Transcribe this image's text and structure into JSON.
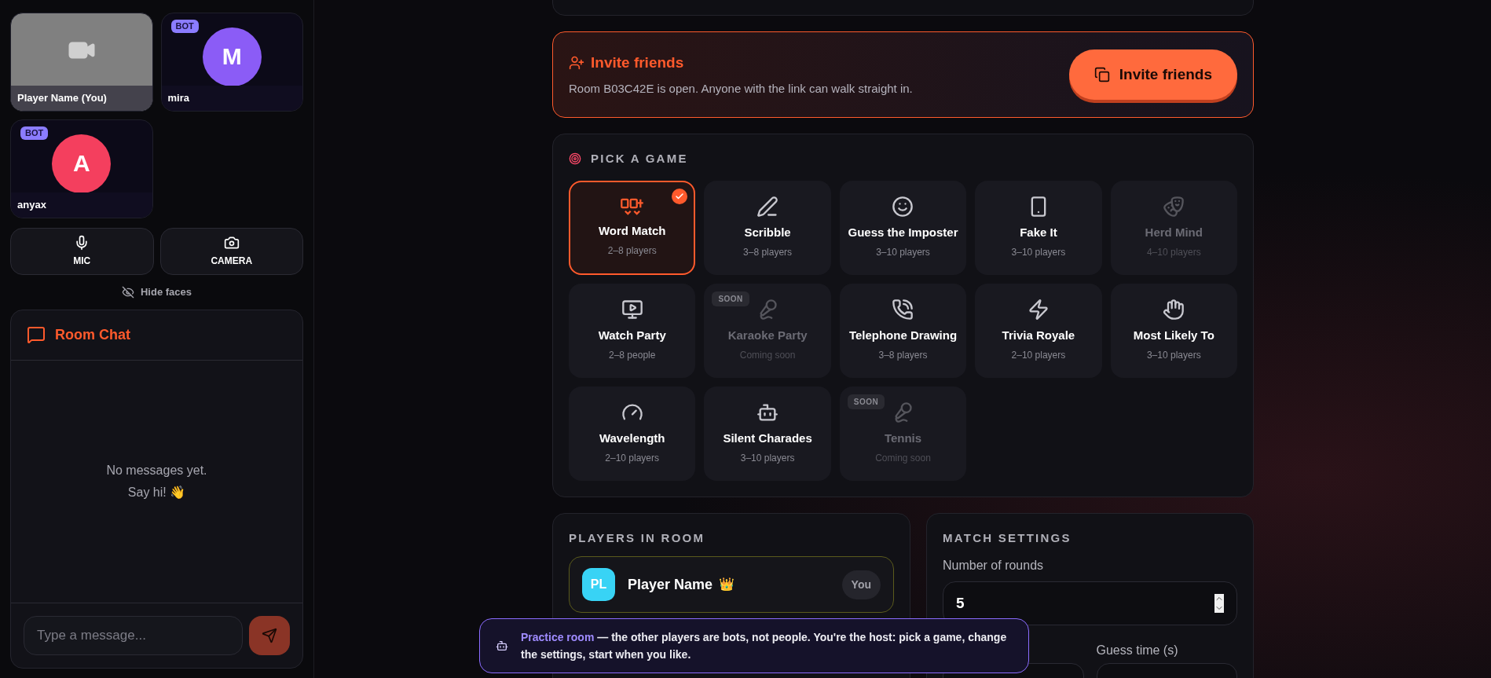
{
  "tiles": [
    {
      "name": "Player Name (You)",
      "kind": "camera"
    },
    {
      "name": "mira",
      "kind": "avatar",
      "badge": "BOT",
      "initial": "M",
      "color": "#8b5cf6"
    },
    {
      "name": "anyax",
      "kind": "avatar",
      "badge": "BOT",
      "initial": "A",
      "color": "#f43f5e"
    }
  ],
  "controls": [
    {
      "label": "MIC"
    },
    {
      "label": "CAMERA"
    }
  ],
  "hide_faces": "Hide faces",
  "chat": {
    "title": "Room Chat",
    "empty": [
      "No messages yet.",
      "Say hi! 👋"
    ],
    "placeholder": "Type a message..."
  },
  "invite": {
    "title": "Invite friends",
    "text": "Room B03C42E is open. Anyone with the link can walk straight in.",
    "button": "Invite friends"
  },
  "pick_game": {
    "title": "PICK A GAME",
    "games": [
      {
        "name": "Word Match",
        "sub": "2–8 players",
        "selected": true,
        "disabled": false
      },
      {
        "name": "Scribble",
        "sub": "3–8 players",
        "selected": false,
        "disabled": false
      },
      {
        "name": "Guess the Imposter",
        "sub": "3–10 players",
        "selected": false,
        "disabled": false
      },
      {
        "name": "Fake It",
        "sub": "3–10 players",
        "selected": false,
        "disabled": false
      },
      {
        "name": "Herd Mind",
        "sub": "4–10 players",
        "selected": false,
        "disabled": true
      },
      {
        "name": "Watch Party",
        "sub": "2–8 people",
        "selected": false,
        "disabled": false
      },
      {
        "name": "Karaoke Party",
        "sub": "Coming soon",
        "selected": false,
        "disabled": true,
        "badge": "SOON"
      },
      {
        "name": "Telephone Drawing",
        "sub": "3–8 players",
        "selected": false,
        "disabled": false
      },
      {
        "name": "Trivia Royale",
        "sub": "2–10 players",
        "selected": false,
        "disabled": false
      },
      {
        "name": "Most Likely To",
        "sub": "3–10 players",
        "selected": false,
        "disabled": false
      },
      {
        "name": "Wavelength",
        "sub": "2–10 players",
        "selected": false,
        "disabled": false
      },
      {
        "name": "Silent Charades",
        "sub": "3–10 players",
        "selected": false,
        "disabled": false
      },
      {
        "name": "Tennis",
        "sub": "Coming soon",
        "selected": false,
        "disabled": true,
        "badge": "SOON"
      }
    ]
  },
  "players": {
    "title": "PLAYERS IN ROOM",
    "list": [
      {
        "initials": "PL",
        "name": "Player Name",
        "crown": "👑",
        "tag": "You"
      }
    ]
  },
  "settings": {
    "title": "MATCH SETTINGS",
    "rounds": {
      "label": "Number of rounds",
      "value": "5"
    },
    "row": [
      {
        "kind": "number"
      },
      {
        "kind": "number",
        "label": "Guess time (s)"
      }
    ]
  },
  "toast": {
    "highlight": "Practice room",
    "text": " — the other players are bots, not people. You're the host: pick a game, change the settings, start when you like."
  }
}
